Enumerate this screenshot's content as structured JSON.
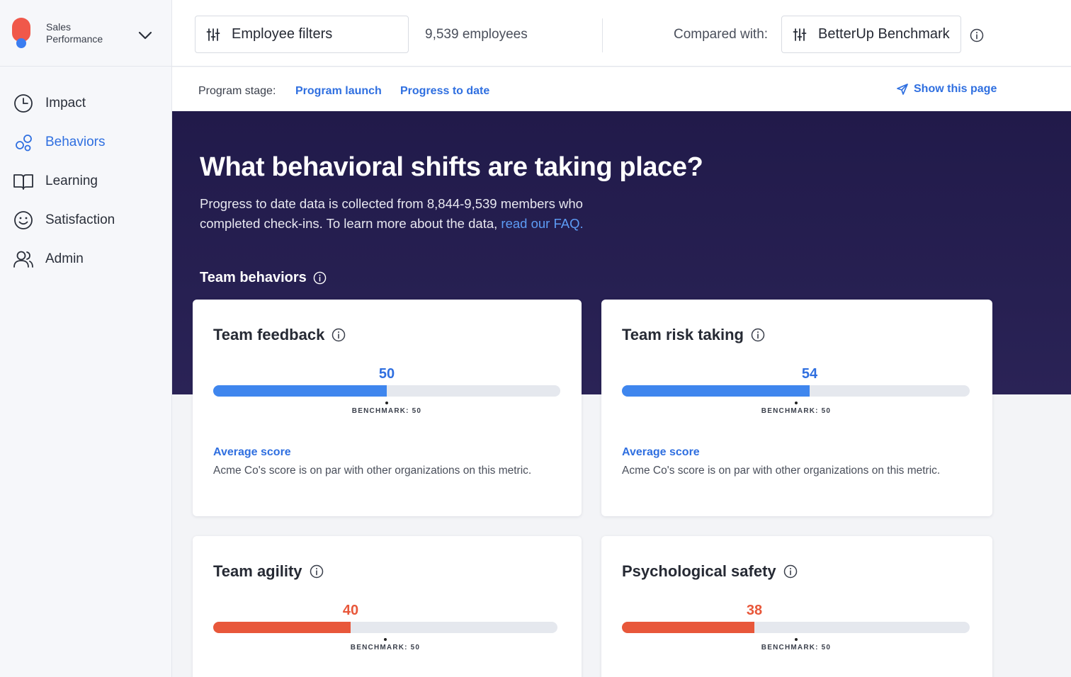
{
  "org": {
    "name": "Sales Performance"
  },
  "nav": [
    {
      "label": "Impact",
      "icon": "clock-icon"
    },
    {
      "label": "Behaviors",
      "icon": "behaviors-icon",
      "active": true
    },
    {
      "label": "Learning",
      "icon": "book-icon"
    },
    {
      "label": "Satisfaction",
      "icon": "smiley-icon"
    },
    {
      "label": "Admin",
      "icon": "users-icon"
    }
  ],
  "topbar": {
    "filter_label": "Employee filters",
    "employee_count": "9,539 employees",
    "compared_label": "Compared with:",
    "benchmark_label": "BetterUp Benchmark"
  },
  "stage": {
    "label": "Program stage:",
    "link1": "Program launch",
    "link2": "Progress to date",
    "show_page": "Show this page"
  },
  "hero": {
    "title": "What behavioral shifts are taking place?",
    "desc": "Progress to date data is collected from 8,844-9,539 members who completed check-ins. To learn more about the data,",
    "faq_link": "read our FAQ.",
    "section": "Team behaviors"
  },
  "colors": {
    "accent": "#2f6fe0",
    "bar_good": "#3f86ee",
    "bar_low": "#e8573a",
    "hero_bg": "#231c4c"
  },
  "cards": [
    {
      "title": "Team feedback",
      "score": 50,
      "score_label": "50",
      "tone": "good",
      "benchmark": 50,
      "benchmark_label": "BENCHMARK: 50",
      "avg_title": "Average score",
      "avg_desc": "Acme Co's score is on par with other organizations on this metric."
    },
    {
      "title": "Team risk taking",
      "score": 54,
      "score_label": "54",
      "tone": "good",
      "benchmark": 50,
      "benchmark_label": "BENCHMARK: 50",
      "avg_title": "Average score",
      "avg_desc": "Acme Co's score is on par with other organizations on this metric."
    },
    {
      "title": "Team agility",
      "score": 40,
      "score_label": "40",
      "tone": "low",
      "benchmark": 50,
      "benchmark_label": "BENCHMARK: 50"
    },
    {
      "title": "Psychological safety",
      "score": 38,
      "score_label": "38",
      "tone": "low",
      "benchmark": 50,
      "benchmark_label": "BENCHMARK: 50"
    }
  ]
}
